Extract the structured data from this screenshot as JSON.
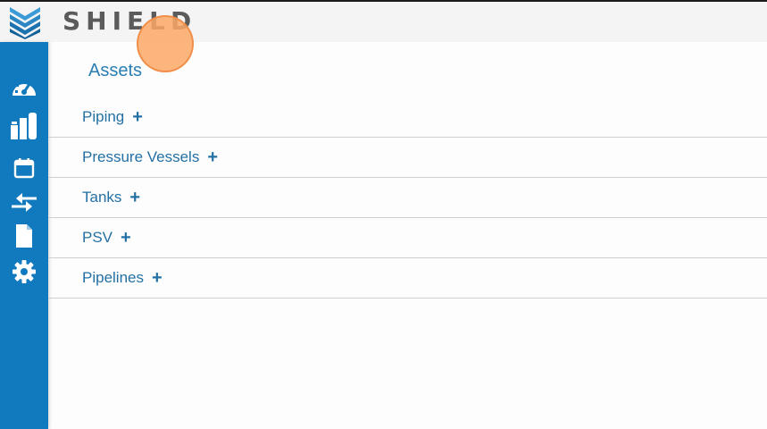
{
  "header": {
    "brand": "SHIELD",
    "logo_icon": "shield-stack-icon"
  },
  "sidebar": {
    "items": [
      {
        "icon": "dashboard-gauge-icon"
      },
      {
        "icon": "refinery-icon"
      },
      {
        "icon": "calendar-icon"
      },
      {
        "icon": "transfer-arrows-icon"
      },
      {
        "icon": "document-icon"
      },
      {
        "icon": "gear-icon"
      }
    ],
    "color": "#1179bd"
  },
  "main": {
    "title": "Assets",
    "assets": [
      {
        "label": "Piping",
        "action": "+"
      },
      {
        "label": "Pressure Vessels",
        "action": "+"
      },
      {
        "label": "Tanks",
        "action": "+"
      },
      {
        "label": "PSV",
        "action": "+"
      },
      {
        "label": "Pipelines",
        "action": "+"
      }
    ]
  },
  "colors": {
    "accent": "#2370a4",
    "sidebar": "#1179bd",
    "cursor": "#fba866"
  }
}
